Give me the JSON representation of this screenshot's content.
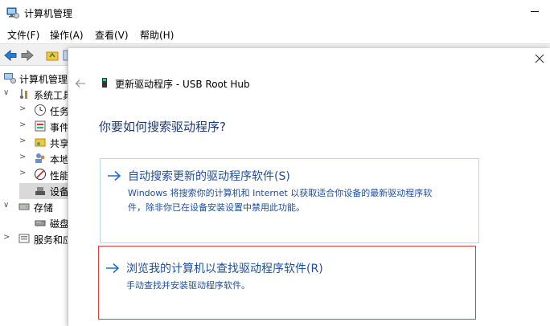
{
  "window": {
    "title": "计算机管理",
    "menu": [
      "文件(F)",
      "操作(A)",
      "查看(V)",
      "帮助(H)"
    ]
  },
  "tree": [
    {
      "label": "计算机管理",
      "icon": "computer-management-icon"
    },
    {
      "label": "系统工具",
      "icon": "tools-icon"
    },
    {
      "label": "任务",
      "icon": "clock-icon"
    },
    {
      "label": "事件",
      "icon": "event-viewer-icon"
    },
    {
      "label": "共享",
      "icon": "shared-folders-icon"
    },
    {
      "label": "本地",
      "icon": "users-icon"
    },
    {
      "label": "性能",
      "icon": "performance-icon"
    },
    {
      "label": "设备",
      "icon": "device-manager-icon"
    },
    {
      "label": "存储",
      "icon": "storage-icon"
    },
    {
      "label": "磁盘",
      "icon": "disk-icon"
    },
    {
      "label": "服务和应",
      "icon": "services-icon"
    }
  ],
  "dialog": {
    "title": "更新驱动程序 - USB Root Hub",
    "heading": "你要如何搜索驱动程序?",
    "auto_option": {
      "title": "自动搜索更新的驱动程序软件(S)",
      "desc_line1": "Windows 将搜索你的计算机和 Internet 以获取适合你设备的最新驱动程序软",
      "desc_line2": "件，除非你已在设备安装设置中禁用此功能。"
    },
    "browse_option": {
      "title": "浏览我的计算机以查找驱动程序软件(R)",
      "desc": "手动查找并安装驱动程序软件。"
    }
  },
  "colors": {
    "accent_text": "#1e4fa0",
    "heading_text": "#1e3a78",
    "highlight_border": "#e53b3b",
    "option_border": "#b7d7ef"
  }
}
